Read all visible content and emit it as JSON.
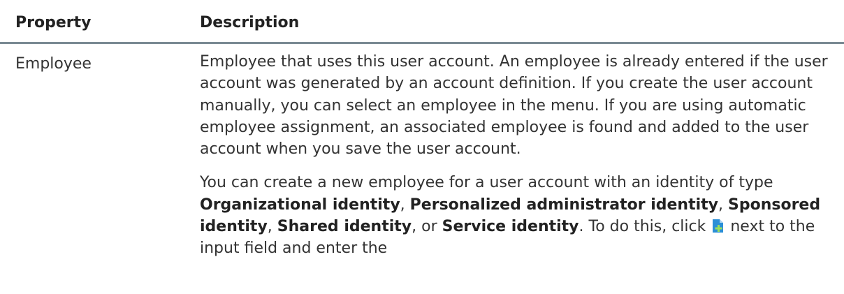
{
  "table": {
    "headers": {
      "property": "Property",
      "description": "Description"
    },
    "row": {
      "property": "Employee",
      "paragraph1": "Employee that uses this user account. An employee is already entered if the user account was generated by an account definition. If you create the user account manually, you can select an employee in the menu. If you are using automatic employee assignment, an associated employee is found and added to the user account when you save the user account.",
      "paragraph2": {
        "part1": "You can create a new employee for a user account with an identity of type ",
        "bold1": "Organizational identity",
        "sep1": ", ",
        "bold2": "Personalized administrator identity",
        "sep2": ", ",
        "bold3": "Sponsored identity",
        "sep3": ", ",
        "bold4": "Shared identity",
        "sep4": ", or ",
        "bold5": "Service identity",
        "part2": ". To do this, click",
        "icon": "add-new-document-icon",
        "part3": " next to the input field and enter the"
      }
    }
  },
  "colors": {
    "icon_fill": "#2b8fd6",
    "icon_plus": "#9be05a",
    "header_rule": "#7a8a93"
  }
}
